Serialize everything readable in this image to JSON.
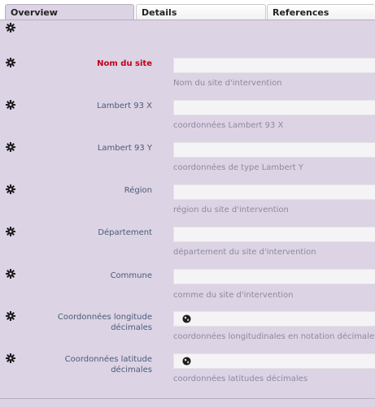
{
  "tabs": [
    {
      "label": "Overview",
      "active": true
    },
    {
      "label": "Details",
      "active": false
    },
    {
      "label": "References",
      "active": false
    }
  ],
  "icons": {
    "settings": "gear-icon",
    "globe": "globe-icon"
  },
  "colors": {
    "panel_bg": "#dcd3e4",
    "required_label": "#c00018",
    "label": "#4a5c78",
    "hint": "#8f8aa0"
  },
  "fields": [
    {
      "label": "Nom du site",
      "required": true,
      "value": "",
      "hint": "Nom du site d'intervention"
    },
    {
      "label": "Lambert 93 X",
      "required": false,
      "value": "",
      "hint": "coordonnées Lambert 93 X"
    },
    {
      "label": "Lambert 93 Y",
      "required": false,
      "value": "",
      "hint": "coordonnées de type Lambert Y"
    },
    {
      "label": "Région",
      "required": false,
      "value": "",
      "hint": "région du site d'intervention"
    },
    {
      "label": "Département",
      "required": false,
      "value": "",
      "hint": "département du site d'intervention"
    },
    {
      "label": "Commune",
      "required": false,
      "value": "",
      "hint": "comme du site d'intervention"
    },
    {
      "label": "Coordonnées longitude décimales",
      "required": false,
      "value": "",
      "hint": "coordonnées longitudinales en notation décimales"
    },
    {
      "label": "Coordonnées latitude décimales",
      "required": false,
      "value": "",
      "hint": "coordonnées latitudes décimales"
    }
  ]
}
